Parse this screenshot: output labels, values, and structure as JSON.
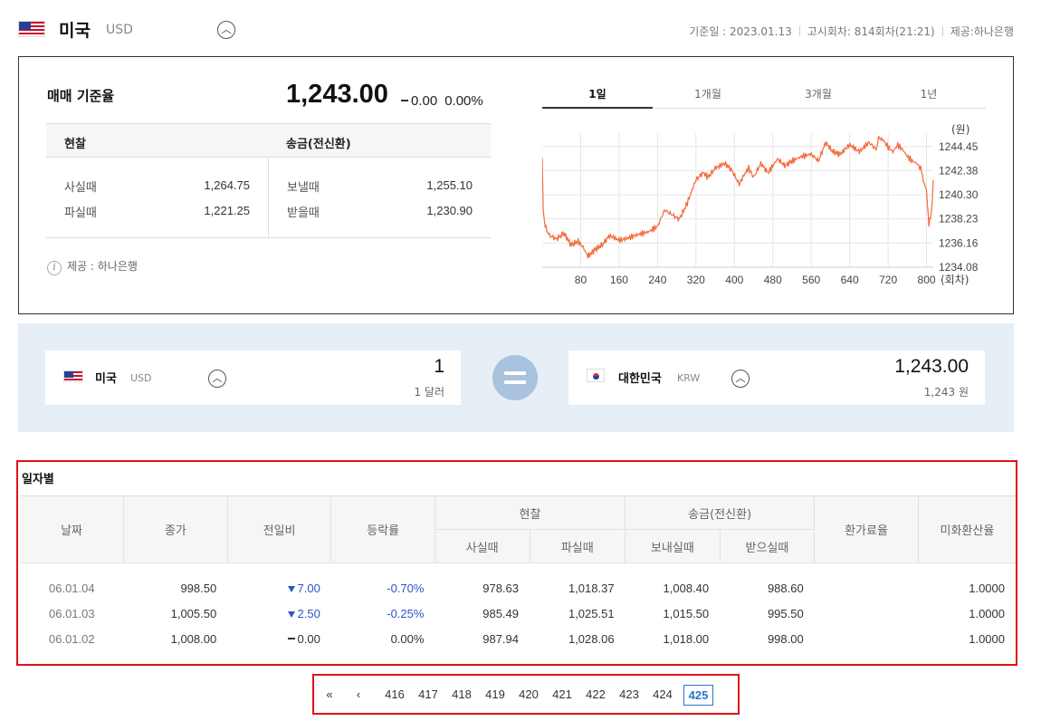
{
  "header": {
    "country": "미국",
    "code": "USD",
    "toggle_icon": "chevron-up-icon",
    "base_date": "기준일 : 2023.01.13",
    "notice": "고시회차: 814회차(21:21)",
    "provider": "제공:하나은행"
  },
  "rate": {
    "title": "매매 기준율",
    "value": "1,243.00",
    "change": "0.00",
    "change_pct": "0.00%",
    "cash_header": "현찰",
    "remit_header": "송금(전신환)",
    "cash_buy_label": "사실때",
    "cash_buy": "1,264.75",
    "cash_sell_label": "파실때",
    "cash_sell": "1,221.25",
    "remit_send_label": "보낼때",
    "remit_send": "1,255.10",
    "remit_recv_label": "받을때",
    "remit_recv": "1,230.90",
    "provider_note": "제공 : 하나은행",
    "info_icon": "info-icon"
  },
  "tabs": [
    "1일",
    "1개월",
    "3개월",
    "1년"
  ],
  "active_tab": 0,
  "chart_data": {
    "type": "line",
    "xlabel": "(회차)",
    "ylabel": "(원)",
    "x_ticks": [
      80,
      160,
      240,
      320,
      400,
      480,
      560,
      640,
      720,
      800
    ],
    "y_ticks": [
      "1234.08",
      "1236.16",
      "1238.23",
      "1240.30",
      "1242.38",
      "1244.45"
    ],
    "xlim": [
      0,
      814
    ],
    "ylim": [
      1234.08,
      1245.6
    ],
    "line_color": "#f26a3b",
    "grid": true,
    "series": [
      {
        "x": [
          0,
          2,
          6,
          15,
          30,
          45,
          60,
          75,
          85,
          95,
          110,
          125,
          140,
          160,
          180,
          200,
          220,
          240,
          255,
          270,
          285,
          300,
          320,
          335,
          345,
          360,
          380,
          395,
          410,
          420,
          430,
          440,
          455,
          470,
          490,
          505,
          520,
          540,
          560,
          575,
          590,
          605,
          620,
          640,
          660,
          680,
          695,
          700,
          710,
          720,
          730,
          740,
          750,
          760,
          770,
          780,
          790,
          795,
          800,
          805,
          810,
          814
        ],
        "y": [
          1243.5,
          1239.0,
          1237.6,
          1236.8,
          1236.5,
          1237.0,
          1236.0,
          1236.3,
          1235.8,
          1235.0,
          1235.6,
          1236.0,
          1236.8,
          1236.4,
          1236.6,
          1236.9,
          1237.1,
          1237.6,
          1239.0,
          1238.6,
          1238.2,
          1239.4,
          1241.6,
          1242.2,
          1241.8,
          1242.6,
          1243.0,
          1242.4,
          1241.2,
          1242.0,
          1242.6,
          1241.8,
          1243.0,
          1242.2,
          1243.4,
          1242.8,
          1243.2,
          1243.6,
          1243.8,
          1243.2,
          1244.8,
          1244.0,
          1243.8,
          1244.6,
          1244.0,
          1244.8,
          1244.2,
          1245.2,
          1245.0,
          1244.4,
          1244.0,
          1244.6,
          1244.2,
          1243.6,
          1243.2,
          1243.0,
          1242.4,
          1241.2,
          1240.6,
          1237.8,
          1238.6,
          1241.6
        ]
      }
    ]
  },
  "converter": {
    "from_country": "미국",
    "from_code": "USD",
    "from_amount": "1",
    "from_amount_text": "1 달러",
    "to_country": "대한민국",
    "to_code": "KRW",
    "to_amount": "1,243.00",
    "to_amount_text": "1,243 원",
    "equals_icon": "equals-icon"
  },
  "daily": {
    "title": "일자별",
    "headers": {
      "date": "날짜",
      "close": "종가",
      "prev_diff": "전일비",
      "change_rate": "등락률",
      "cash": "현찰",
      "cash_buy": "사실때",
      "cash_sell": "파실때",
      "remit": "송금(전신환)",
      "remit_send": "보내실때",
      "remit_recv": "받으실때",
      "fee": "환가료율",
      "usd_rate": "미화환산율"
    },
    "rows": [
      {
        "date": "06.01.04",
        "close": "998.50",
        "diff": "7.00",
        "diff_dir": "down",
        "rate": "-0.70%",
        "cash_buy": "978.63",
        "cash_sell": "1,018.37",
        "send": "1,008.40",
        "recv": "988.60",
        "fee": "",
        "usd": "1.0000"
      },
      {
        "date": "06.01.03",
        "close": "1,005.50",
        "diff": "2.50",
        "diff_dir": "down",
        "rate": "-0.25%",
        "cash_buy": "985.49",
        "cash_sell": "1,025.51",
        "send": "1,015.50",
        "recv": "995.50",
        "fee": "",
        "usd": "1.0000"
      },
      {
        "date": "06.01.02",
        "close": "1,008.00",
        "diff": "0.00",
        "diff_dir": "flat",
        "rate": "0.00%",
        "cash_buy": "987.94",
        "cash_sell": "1,028.06",
        "send": "1,018.00",
        "recv": "998.00",
        "fee": "",
        "usd": "1.0000"
      }
    ]
  },
  "pagination": {
    "first": "«",
    "prev": "‹",
    "pages": [
      "416",
      "417",
      "418",
      "419",
      "420",
      "421",
      "422",
      "423",
      "424",
      "425"
    ],
    "current": "425"
  }
}
